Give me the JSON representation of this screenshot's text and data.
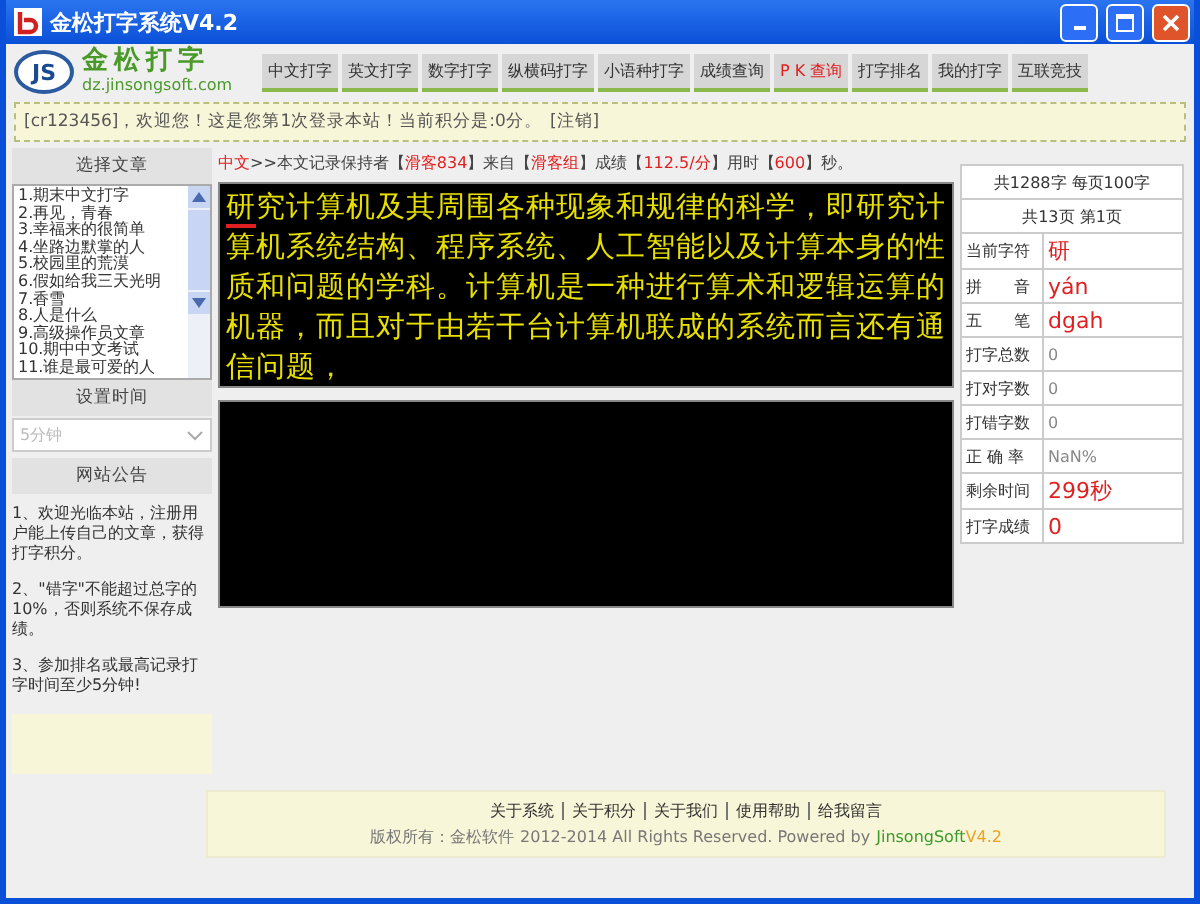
{
  "window": {
    "title": "金松打字系统V4.2"
  },
  "logo": {
    "name": "金松打字",
    "url": "dz.jinsongsoft.com",
    "badge": "JS"
  },
  "nav": [
    {
      "label": "中文打字",
      "color": "#333333"
    },
    {
      "label": "英文打字",
      "color": "#333333"
    },
    {
      "label": "数字打字",
      "color": "#333333"
    },
    {
      "label": "纵横码打字",
      "color": "#333333"
    },
    {
      "label": "小语种打字",
      "color": "#333333"
    },
    {
      "label": "成绩查询",
      "color": "#333333"
    },
    {
      "label": "P K 查询",
      "color": "#e02020"
    },
    {
      "label": "打字排名",
      "color": "#333333"
    },
    {
      "label": "我的打字",
      "color": "#333333"
    },
    {
      "label": "互联竞技",
      "color": "#333333"
    }
  ],
  "welcome": {
    "text": "[cr123456]，欢迎您！这是您第1次登录本站！当前积分是:0分。",
    "logout": "[注销]"
  },
  "article_list": {
    "title": "选择文章",
    "items": [
      {
        "label": "1.期末中文打字",
        "selected": false
      },
      {
        "label": "2.再见，青春",
        "selected": false
      },
      {
        "label": "3.幸福来的很简单",
        "selected": false
      },
      {
        "label": "4.坐路边默掌的人",
        "selected": false
      },
      {
        "label": "5.校园里的荒漠",
        "selected": false
      },
      {
        "label": "6.假如给我三天光明",
        "selected": false
      },
      {
        "label": "7.香雪",
        "selected": false
      },
      {
        "label": "8.人是什么",
        "selected": false
      },
      {
        "label": "9.高级操作员文章",
        "selected": false
      },
      {
        "label": "10.期中中文考试",
        "selected": false
      },
      {
        "label": "11.谁是最可爱的人",
        "selected": false
      }
    ]
  },
  "time": {
    "title": "设置时间",
    "placeholder": "5分钟"
  },
  "notices": {
    "title": "网站公告",
    "items": [
      "1、欢迎光临本站，注册用户能上传自己的文章，获得打字积分。",
      "2、\"错字\"不能超过总字的10%，否则系统不保存成绩。",
      "3、参加排名或最高记录打字时间至少5分钟!"
    ]
  },
  "record": [
    {
      "text": "中文",
      "highlight": true
    },
    {
      "text": ">>本文记录保持者【",
      "highlight": false
    },
    {
      "text": "滑客834",
      "highlight": true
    },
    {
      "text": "】来自【",
      "highlight": false
    },
    {
      "text": "滑客组",
      "highlight": true
    },
    {
      "text": "】成绩【",
      "highlight": false
    },
    {
      "text": "112.5/分",
      "highlight": true
    },
    {
      "text": "】用时【",
      "highlight": false
    },
    {
      "text": "600",
      "highlight": true
    },
    {
      "text": "】秒。",
      "highlight": false
    }
  ],
  "passage": {
    "current": "研",
    "rest": "究计算机及其周围各种现象和规律的科学，即研究计算机系统结构、程序系统、人工智能以及计算本身的性质和问题的学科。计算机是一种进行算术和逻辑运算的机器，而且对于由若干台计算机联成的系统而言还有通信问题，"
  },
  "stats": {
    "summary": [
      "共1288字 每页100字",
      "共13页 第1页"
    ],
    "rows": [
      {
        "label": "当前字符",
        "value": "研",
        "kind": "big"
      },
      {
        "label": "拼　　音",
        "value": "yán",
        "kind": "big"
      },
      {
        "label": "五　　笔",
        "value": "dgah",
        "kind": "big"
      },
      {
        "label": "打字总数",
        "value": "0",
        "kind": "small"
      },
      {
        "label": "打对字数",
        "value": "0",
        "kind": "small"
      },
      {
        "label": "打错字数",
        "value": "0",
        "kind": "small"
      },
      {
        "label": "正 确 率",
        "value": "NaN%",
        "kind": "small"
      },
      {
        "label": "剩余时间",
        "value": "299秒",
        "kind": "big"
      },
      {
        "label": "打字成绩",
        "value": "0",
        "kind": "big"
      }
    ]
  },
  "footer": {
    "links": [
      "关于系统",
      "关于积分",
      "关于我们",
      "使用帮助",
      "给我留言"
    ],
    "copyright": "版权所有：金松软件",
    "rights": "2012-2014 All Rights Reserved. Powered by",
    "brand": "JinsongSoft",
    "version": "V4.2"
  }
}
